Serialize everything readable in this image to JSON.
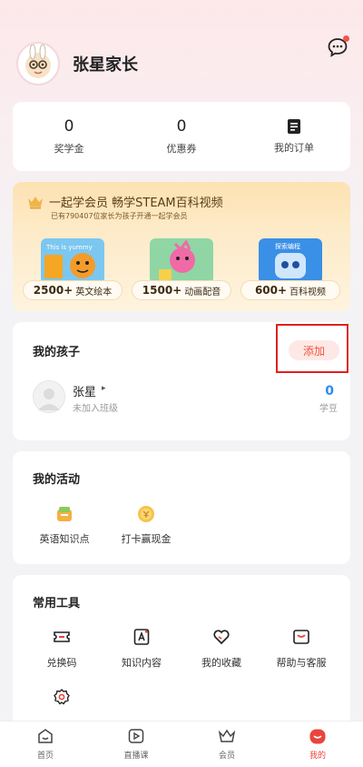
{
  "profile": {
    "name": "张星家长"
  },
  "stats": [
    {
      "value": "0",
      "label": "奖学金"
    },
    {
      "value": "0",
      "label": "优惠券"
    },
    {
      "label": "我的订单"
    }
  ],
  "vip": {
    "title": "一起学会员 畅学STEAM百科视频",
    "subtitle": "已有790407位家长为孩子开通一起学会员",
    "items": [
      {
        "count": "2500+",
        "label": "英文绘本",
        "thumb_text": "This is yummy"
      },
      {
        "count": "1500+",
        "label": "动画配音"
      },
      {
        "count": "600+",
        "label": "百科视频",
        "thumb_text": "探索编程"
      }
    ]
  },
  "kids": {
    "title": "我的孩子",
    "add_label": "添加",
    "child": {
      "name": "张星",
      "status": "未加入班级",
      "beans": "0",
      "beans_label": "学豆"
    }
  },
  "activity": {
    "title": "我的活动",
    "items": [
      {
        "label": "英语知识点",
        "icon": "book-stack-icon"
      },
      {
        "label": "打卡赢现金",
        "icon": "coin-medal-icon"
      }
    ]
  },
  "tools": {
    "title": "常用工具",
    "items": [
      {
        "label": "兑换码",
        "icon": "ticket-icon"
      },
      {
        "label": "知识内容",
        "icon": "document-a-icon"
      },
      {
        "label": "我的收藏",
        "icon": "heart-icon"
      },
      {
        "label": "帮助与客服",
        "icon": "help-mail-icon"
      },
      {
        "label": "",
        "icon": "settings-gear-icon"
      }
    ]
  },
  "tabs": [
    {
      "label": "首页",
      "icon": "home-icon"
    },
    {
      "label": "直播课",
      "icon": "play-video-icon"
    },
    {
      "label": "会员",
      "icon": "crown-icon"
    },
    {
      "label": "我的",
      "icon": "profile-face-icon",
      "active": true
    }
  ],
  "colors": {
    "accent": "#e8453c",
    "beans": "#2a8cf0",
    "vip_gold": "#fde2b2",
    "highlight_box": "#e02020"
  }
}
